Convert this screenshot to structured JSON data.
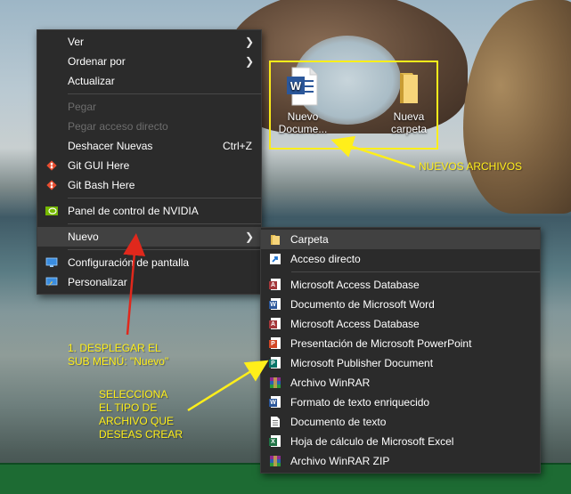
{
  "context_menu": {
    "items": [
      {
        "label": "Ver"
      },
      {
        "label": "Ordenar por"
      },
      {
        "label": "Actualizar"
      },
      {
        "label": "Pegar"
      },
      {
        "label": "Pegar acceso directo"
      },
      {
        "label": "Deshacer Nuevas",
        "shortcut": "Ctrl+Z"
      },
      {
        "label": "Git GUI Here"
      },
      {
        "label": "Git Bash Here"
      },
      {
        "label": "Panel de control de NVIDIA"
      },
      {
        "label": "Nuevo"
      },
      {
        "label": "Configuración de pantalla"
      },
      {
        "label": "Personalizar"
      }
    ]
  },
  "submenu": {
    "items": [
      {
        "label": "Carpeta"
      },
      {
        "label": "Acceso directo"
      },
      {
        "label": "Microsoft Access Database"
      },
      {
        "label": "Documento de Microsoft Word"
      },
      {
        "label": "Microsoft Access Database"
      },
      {
        "label": "Presentación de Microsoft PowerPoint"
      },
      {
        "label": "Microsoft Publisher Document"
      },
      {
        "label": "Archivo WinRAR"
      },
      {
        "label": "Formato de texto enriquecido"
      },
      {
        "label": "Documento de texto"
      },
      {
        "label": "Hoja de cálculo de Microsoft Excel"
      },
      {
        "label": "Archivo WinRAR ZIP"
      }
    ]
  },
  "desktop_icons": [
    {
      "line1": "Nuevo",
      "line2": "Docume...",
      "icon": "word-document-icon"
    },
    {
      "line1": "Nueva",
      "line2": "carpeta",
      "icon": "folder-icon"
    }
  ],
  "annotations": {
    "nuevos_archivos": "NUEVOS ARCHIVOS",
    "step1_line1": "1. DESPLEGAR EL",
    "step1_line2": "SUB MENÚ: \"Nuevo\"",
    "step2_line1": "SELECCIONA",
    "step2_line2": "EL TIPO DE",
    "step2_line3": "ARCHIVO QUE",
    "step2_line4": "DESEAS CREAR"
  },
  "colors": {
    "annotation": "#ffef1a",
    "arrow_red": "#e0281c",
    "menu_bg": "#2b2b2b",
    "menu_highlight": "#414141"
  }
}
